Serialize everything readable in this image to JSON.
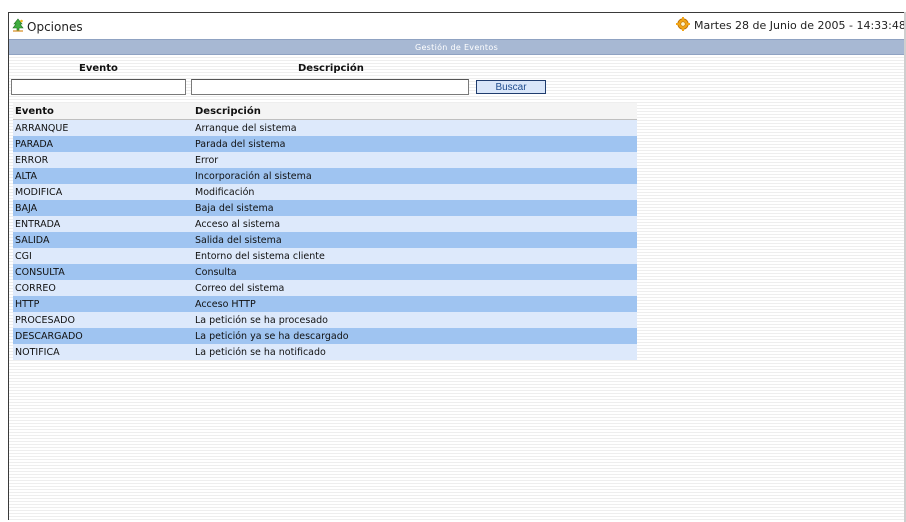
{
  "topbar": {
    "options_label": "Opciones",
    "options_icon": "tree-icon",
    "datetime": "Martes 28 de Junio de 2005 - 14:33:48 -",
    "datetime_icon": "gear-icon"
  },
  "page": {
    "title": "Gestión de Eventos"
  },
  "filters": {
    "evento_label": "Evento",
    "descripcion_label": "Descripción",
    "evento_value": "",
    "descripcion_value": "",
    "search_label": "Buscar"
  },
  "table": {
    "headers": [
      "Evento",
      "Descripción"
    ],
    "rows": [
      [
        "ARRANQUE",
        "Arranque del sistema"
      ],
      [
        "PARADA",
        "Parada del sistema"
      ],
      [
        "ERROR",
        "Error"
      ],
      [
        "ALTA",
        "Incorporación al sistema"
      ],
      [
        "MODIFICA",
        "Modificación"
      ],
      [
        "BAJA",
        "Baja del sistema"
      ],
      [
        "ENTRADA",
        "Acceso al sistema"
      ],
      [
        "SALIDA",
        "Salida del sistema"
      ],
      [
        "CGI",
        "Entorno del sistema cliente"
      ],
      [
        "CONSULTA",
        "Consulta"
      ],
      [
        "CORREO",
        "Correo del sistema"
      ],
      [
        "HTTP",
        "Acceso HTTP"
      ],
      [
        "PROCESADO",
        "La petición se ha procesado"
      ],
      [
        "DESCARGADO",
        "La petición ya se ha descargado"
      ],
      [
        "NOTIFICA",
        "La petición se ha notificado"
      ]
    ]
  },
  "colors": {
    "row_light": "#dde9fb",
    "row_dark": "#9fc4f1",
    "title_bar": "#a7b8d3",
    "button_bg": "#d9e6f9"
  }
}
